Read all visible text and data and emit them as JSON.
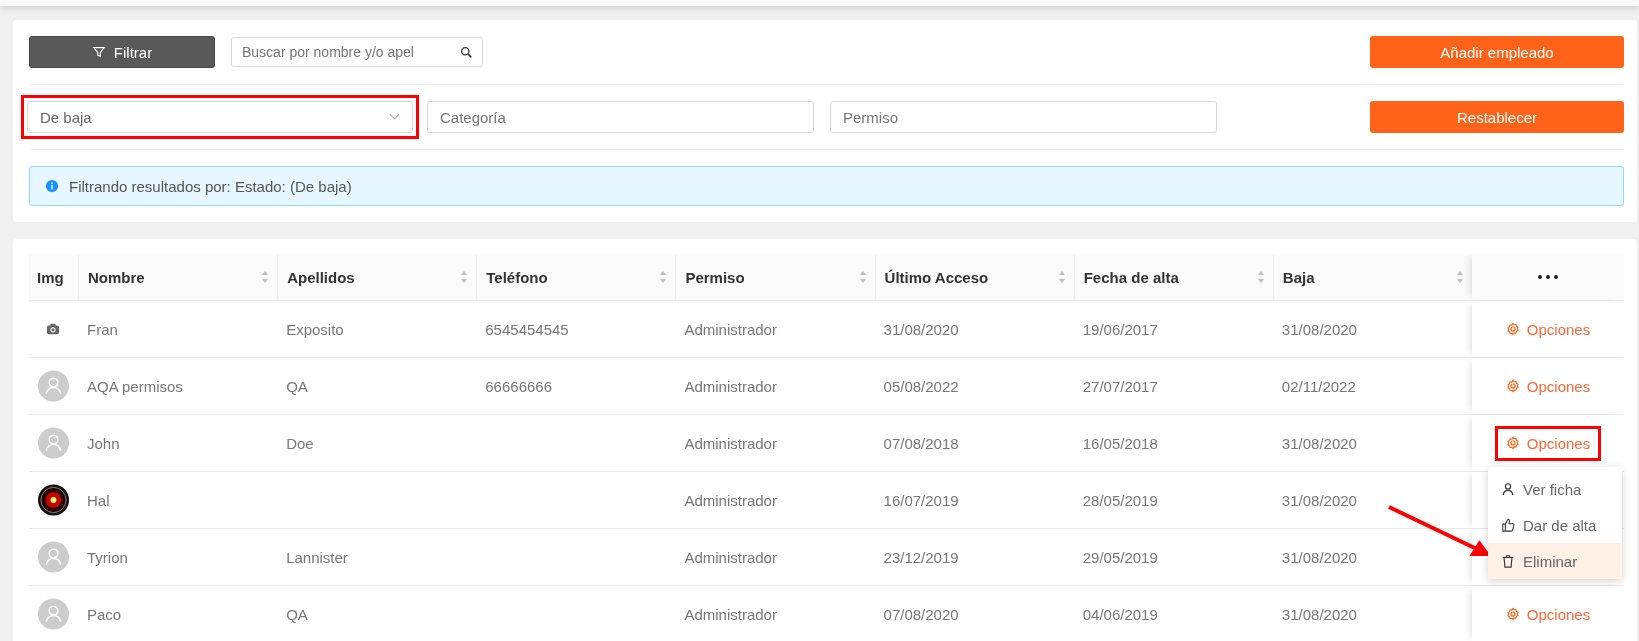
{
  "filters": {
    "filter_button": "Filtrar",
    "search": {
      "placeholder": "Buscar por nombre y/o apel"
    },
    "add_button": "Añadir empleado",
    "status_select": {
      "value": "De baja",
      "highlighted": true
    },
    "category_field": {
      "placeholder": "Categoría"
    },
    "permission_field": {
      "placeholder": "Permiso"
    },
    "reset_button": "Restablecer",
    "info": "Filtrando resultados por: Estado: (De baja)"
  },
  "table": {
    "columns": [
      {
        "label": "Img",
        "sortable": false
      },
      {
        "label": "Nombre",
        "sortable": true
      },
      {
        "label": "Apellidos",
        "sortable": true
      },
      {
        "label": "Teléfono",
        "sortable": true
      },
      {
        "label": "Permiso",
        "sortable": true
      },
      {
        "label": "Último Acceso",
        "sortable": true
      },
      {
        "label": "Fecha de alta",
        "sortable": true
      },
      {
        "label": "Baja",
        "sortable": true
      }
    ],
    "rows": [
      {
        "kind": "camera",
        "cells": [
          "",
          "Fran",
          "Exposito",
          "6545454545",
          "Administrador",
          "31/08/2020",
          "19/06/2017",
          "31/08/2020"
        ],
        "options": "Opciones",
        "highlighted": false,
        "menu_open": false
      },
      {
        "kind": "person",
        "cells": [
          "",
          "AQA permisos",
          "QA",
          "66666666",
          "Administrador",
          "05/08/2022",
          "27/07/2017",
          "02/11/2022"
        ],
        "options": "Opciones",
        "highlighted": false,
        "menu_open": false
      },
      {
        "kind": "person",
        "cells": [
          "",
          "John",
          "Doe",
          "",
          "Administrador",
          "07/08/2018",
          "16/05/2018",
          "31/08/2020"
        ],
        "options": "Opciones",
        "highlighted": true,
        "menu_open": true
      },
      {
        "kind": "lens",
        "cells": [
          "",
          "Hal",
          "",
          "",
          "Administrador",
          "16/07/2019",
          "28/05/2019",
          "31/08/2020"
        ]
      },
      {
        "kind": "person",
        "cells": [
          "",
          "Tyrion",
          "Lannister",
          "",
          "Administrador",
          "23/12/2019",
          "29/05/2019",
          "31/08/2020"
        ]
      },
      {
        "kind": "person",
        "cells": [
          "",
          "Paco",
          "QA",
          "",
          "Administrador",
          "07/08/2020",
          "04/06/2019",
          "31/08/2020"
        ],
        "options": "Opciones",
        "highlighted": false,
        "menu_open": false
      }
    ],
    "menu": [
      {
        "kind": "view",
        "label": "Ver ficha",
        "selected": false
      },
      {
        "kind": "activate",
        "label": "Dar de alta",
        "selected": false
      },
      {
        "kind": "delete",
        "label": "Eliminar",
        "selected": true
      }
    ]
  }
}
